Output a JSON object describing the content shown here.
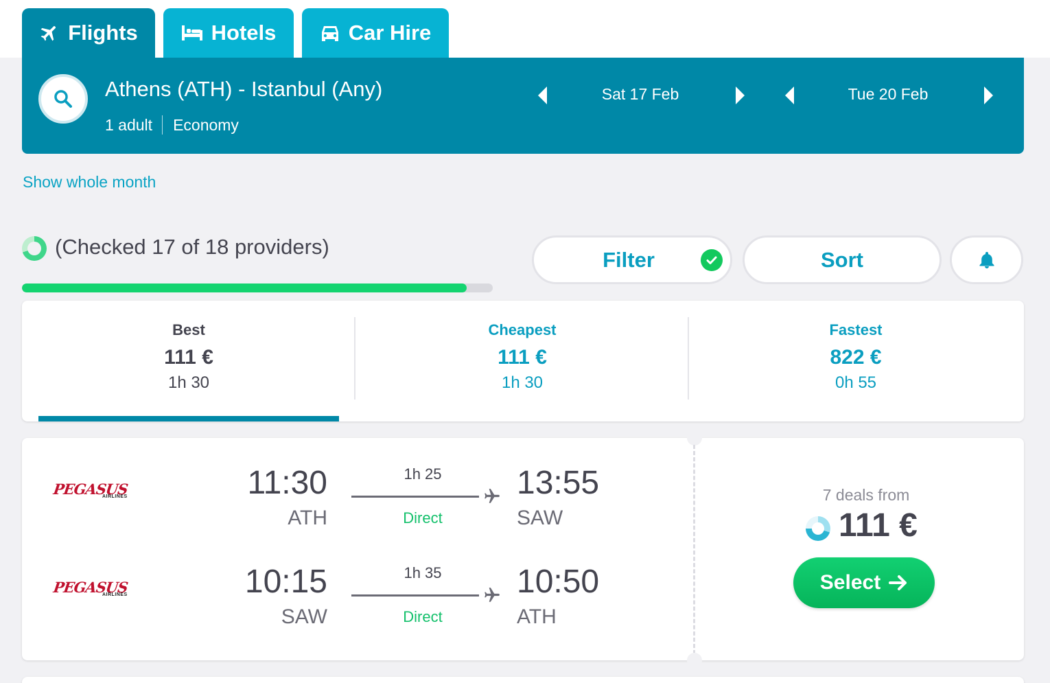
{
  "tabs": [
    {
      "label": "Flights",
      "icon": "plane-icon",
      "active": true
    },
    {
      "label": "Hotels",
      "icon": "bed-icon",
      "active": false
    },
    {
      "label": "Car Hire",
      "icon": "car-icon",
      "active": false
    }
  ],
  "search": {
    "route": "Athens (ATH) - Istanbul (Any)",
    "passengers": "1 adult",
    "cabin": "Economy",
    "depart_date": "Sat 17 Feb",
    "return_date": "Tue 20 Feb"
  },
  "show_whole_month": "Show whole month",
  "progress": {
    "text": "(Checked 17 of 18 providers)",
    "fraction": 0.944
  },
  "actions": {
    "filter_label": "Filter",
    "sort_label": "Sort",
    "alert_icon": "bell-icon"
  },
  "sort_options": [
    {
      "label": "Best",
      "price": "111 €",
      "duration": "1h 30"
    },
    {
      "label": "Cheapest",
      "price": "111 €",
      "duration": "1h 30"
    },
    {
      "label": "Fastest",
      "price": "822 €",
      "duration": "0h 55"
    }
  ],
  "result": {
    "legs": [
      {
        "airline": "PEGASUS",
        "airline_sub": "AIRLINES",
        "dep_time": "11:30",
        "dep_code": "ATH",
        "duration": "1h 25",
        "stops": "Direct",
        "arr_time": "13:55",
        "arr_code": "SAW"
      },
      {
        "airline": "PEGASUS",
        "airline_sub": "AIRLINES",
        "dep_time": "10:15",
        "dep_code": "SAW",
        "duration": "1h 35",
        "stops": "Direct",
        "arr_time": "10:50",
        "arr_code": "ATH"
      }
    ],
    "deals": "7 deals from",
    "price": "111 €",
    "select_label": "Select"
  },
  "colors": {
    "brand": "#0088a7",
    "tab_inactive": "#07b3d3",
    "accent_green": "#13c95e",
    "link": "#0aa3c4"
  }
}
